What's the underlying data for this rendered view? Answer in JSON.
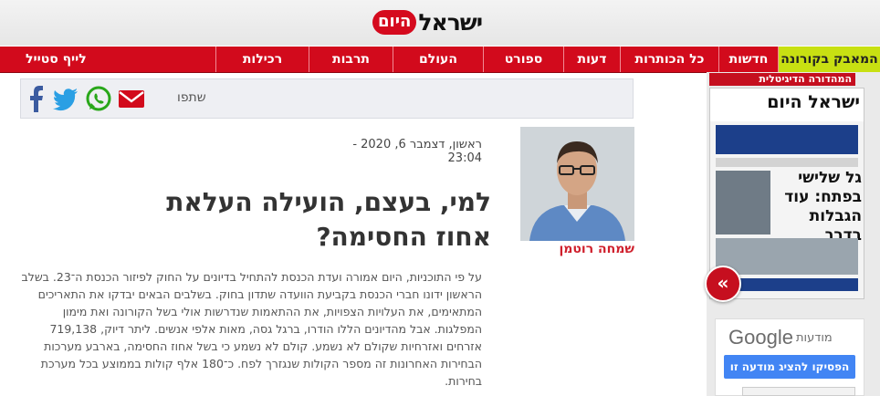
{
  "site": {
    "logo_word": "ישראל",
    "logo_badge": "היום"
  },
  "nav": {
    "items": [
      "המאבק בקורונה",
      "חדשות",
      "כל הכותרות",
      "דעות",
      "ספורט",
      "העולם",
      "תרבות",
      "רכילות",
      "לייף סטייל"
    ]
  },
  "share": {
    "label": "שתפו",
    "icons": [
      "mail-icon",
      "whatsapp-icon",
      "twitter-icon",
      "facebook-icon"
    ]
  },
  "article": {
    "date": "ראשון, דצמבר 6, 2020 - 23:04",
    "headline": "למי, בעצם, הועילה העלאת אחוז החסימה?",
    "body": "על פי התוכניות, היום אמורה ועדת הכנסת להתחיל בדיונים על החוק לפיזור הכנסת ה־23. בשלב הראשון ידונו חברי הכנסת בקביעת הוועדה שתדון בחוק. בשלבים הבאים יבדקו את התאריכים המתאימים, את העלויות הצפויות, את ההתאמות שנדרשות אולי בשל הקורונה ואת מימון המפלגות. אבל מהדיונים הללו הודרו, ברגל גסה, מאות אלפי אנשים. ליתר דיוק, 719,138 אזרחים ואזרחיות שקולם לא נשמע. קולם לא נשמע כי בשל אחוז החסימה, בארבע מערכות הבחירות האחרונות זה מספר הקולות שנגזרך לפח. כ־180 אלף קולות בממוצע בכל מערכת בחירות.",
    "author": "שמחה רוטמן"
  },
  "sidebar": {
    "digital_label": "המהדורה הדיגיטלית",
    "paper_logo": "ישראל היום",
    "paper_headline_line1": "גל שלישי",
    "paper_headline_line2": "בפתח: עוד",
    "paper_headline_line3": "הגבלות בדרך",
    "arrow": "«"
  },
  "ad": {
    "brand": "Google",
    "word": "מודעות",
    "button": "הפסיקו להציג מודעה זו"
  },
  "colors": {
    "brand_red": "#d20a1c",
    "promo_green": "#c8e012",
    "author_red": "#cf1f2c"
  }
}
